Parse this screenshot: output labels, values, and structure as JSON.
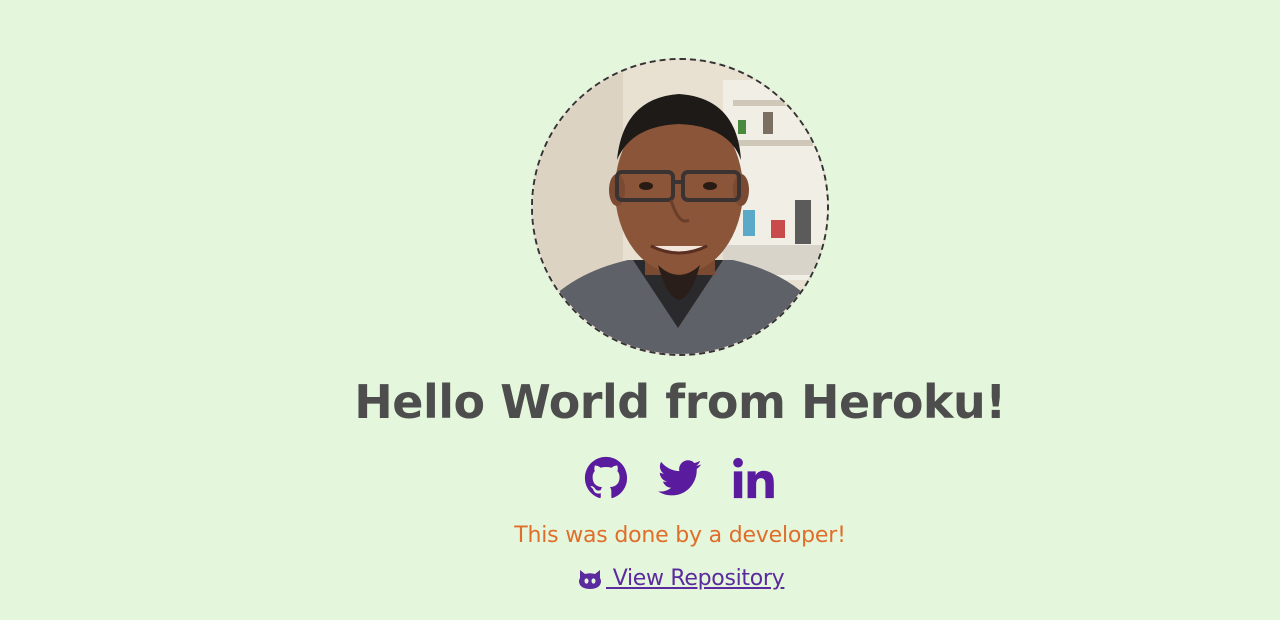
{
  "profile": {
    "avatar_alt": "Developer profile photo"
  },
  "heading": {
    "title": "Hello World from Heroku!"
  },
  "social": {
    "icons": [
      "github-icon",
      "twitter-icon",
      "linkedin-icon"
    ]
  },
  "tagline": "This was done by a developer!",
  "repository": {
    "label": " View Repository",
    "icon": "github-octocat-icon"
  },
  "colors": {
    "background": "#e4f7dc",
    "heading": "#4d4d4d",
    "icon_purple": "#5b1b9e",
    "tagline_orange": "#e06d2a",
    "link_purple": "#5a2a9e"
  }
}
